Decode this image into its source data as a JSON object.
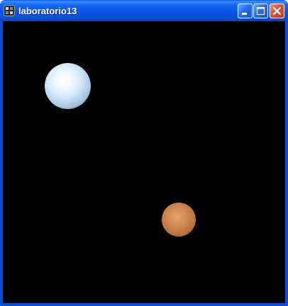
{
  "window": {
    "title": "laboratorio13",
    "app_icon": "program-icon",
    "buttons": {
      "minimize": "minimize-icon",
      "maximize": "maximize-icon",
      "close": "close-icon"
    }
  },
  "canvas": {
    "background": "#000000",
    "spheres": [
      {
        "name": "white-sphere",
        "color": "#d8ecff"
      },
      {
        "name": "orange-sphere",
        "color": "#d48a52"
      }
    ]
  }
}
